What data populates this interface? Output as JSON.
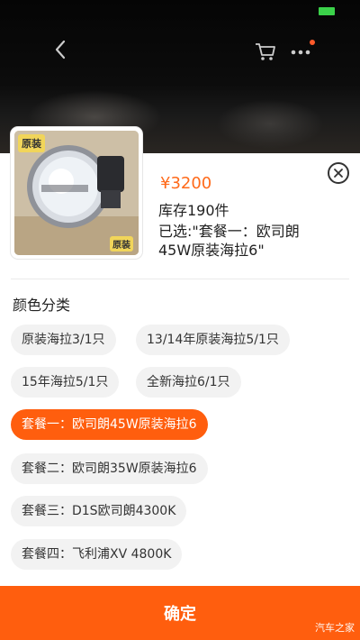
{
  "header": {
    "back_icon": "chevron-left-icon",
    "cart_icon": "cart-icon",
    "more_icon": "more-icon"
  },
  "product": {
    "price": "¥3200",
    "stock": "库存190件",
    "selected": "已选:\"套餐一：欧司朗45W原装海拉6\"",
    "thumb_tag_top": "原装",
    "thumb_tag_bottom": "原装"
  },
  "options": {
    "title": "颜色分类",
    "items": [
      {
        "label": "原装海拉3/1只",
        "active": false
      },
      {
        "label": "13/14年原装海拉5/1只",
        "active": false
      },
      {
        "label": "15年海拉5/1只",
        "active": false
      },
      {
        "label": "全新海拉6/1只",
        "active": false
      },
      {
        "label": "套餐一：欧司朗45W原装海拉6",
        "active": true
      },
      {
        "label": "套餐二：欧司朗35W原装海拉6",
        "active": false
      },
      {
        "label": "套餐三：D1S欧司朗4300K",
        "active": false
      },
      {
        "label": "套餐四：飞利浦XV 4800K",
        "active": false
      }
    ]
  },
  "footer": {
    "confirm_label": "确定",
    "watermark": "汽车之家"
  },
  "colors": {
    "accent": "#ff5e0e",
    "price": "#ff6a1a",
    "chip_bg": "#f2f2f2"
  }
}
